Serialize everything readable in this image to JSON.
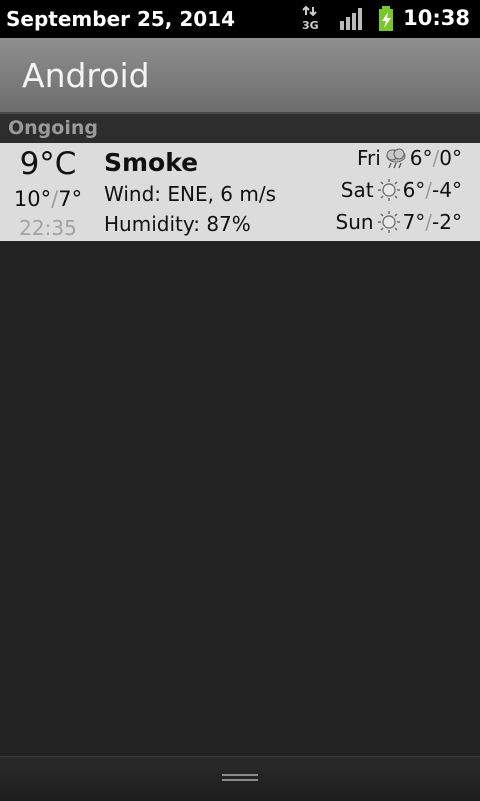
{
  "status_bar": {
    "date": "September 25, 2014",
    "time": "10:38",
    "network_label": "3G",
    "icons": [
      "network-3g-icon",
      "signal-icon",
      "battery-charging-icon"
    ]
  },
  "header": {
    "title": "Android"
  },
  "section": {
    "label": "Ongoing"
  },
  "weather": {
    "current_temp": "9°C",
    "high": "10°",
    "low": "7°",
    "range_sep": "/",
    "update_time": "22:35",
    "condition": "Smoke",
    "wind": "Wind: ENE, 6 m/s",
    "humidity": "Humidity: 87%",
    "forecast": [
      {
        "day": "Fri",
        "icon": "cloud-rain-icon",
        "high": "6°",
        "low": "0°"
      },
      {
        "day": "Sat",
        "icon": "sun-icon",
        "high": "6°",
        "low": "-4°"
      },
      {
        "day": "Sun",
        "icon": "sun-icon",
        "high": "7°",
        "low": "-2°"
      }
    ]
  },
  "colors": {
    "status_bar": "#000000",
    "title_bar": "#7e7e7e",
    "notification_bg": "#dcdcdc",
    "background": "#222222",
    "battery_green": "#7ac72b"
  }
}
